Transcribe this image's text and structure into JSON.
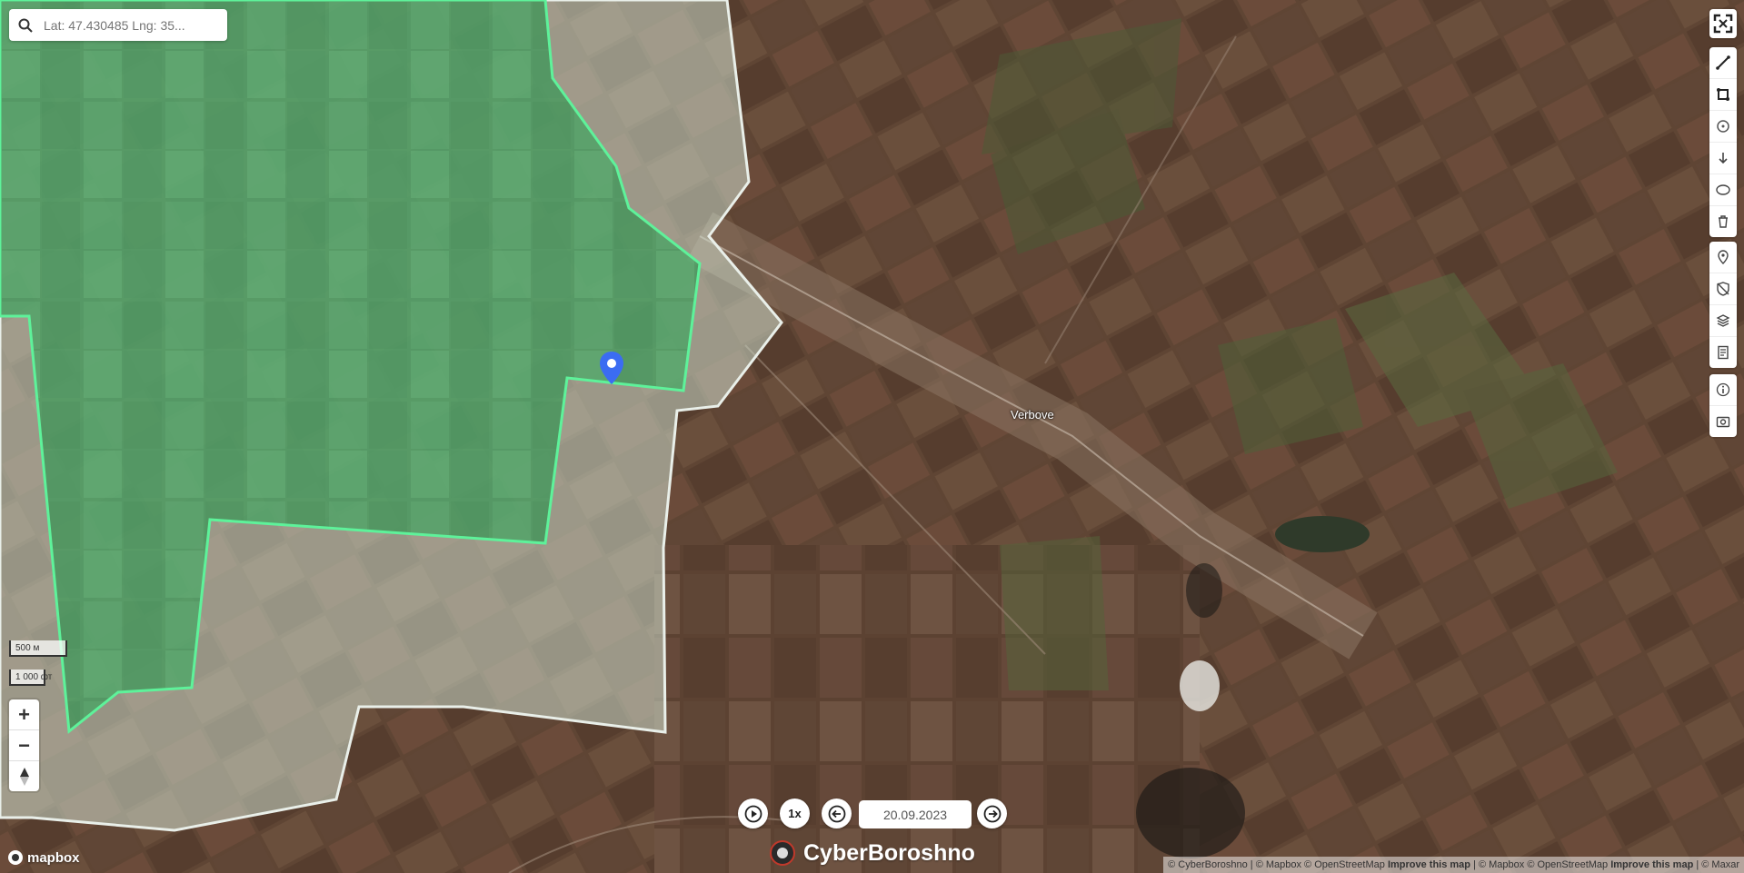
{
  "search": {
    "placeholder": "Lat: 47.430485 Lng: 35..."
  },
  "map": {
    "place_label": "Verbove",
    "colors": {
      "terrain": "#5e4332",
      "controlled_fill": "#43c36e",
      "controlled_border": "#5ef29a",
      "gray_zone_fill": "#c8d9c8",
      "gray_zone_border": "#e8eee8",
      "marker": "#3b6cf2"
    },
    "marker_icon": "map-pin-icon"
  },
  "scale": {
    "metric": "500 м",
    "imperial": "1 000 фт"
  },
  "zoom": {
    "in": "+",
    "out": "−",
    "compass": "compass-icon"
  },
  "toolbar": {
    "fullscreen_icon": "fullscreen-icon",
    "draw_tools": [
      "line-icon",
      "polygon-icon",
      "circle-icon",
      "arrow-down-icon",
      "ellipse-icon",
      "trash-icon"
    ],
    "layer_tools": [
      "pin-icon",
      "shield-icon",
      "layers-icon",
      "document-icon"
    ],
    "info_tools": [
      "info-icon",
      "screenshot-icon"
    ]
  },
  "timeline": {
    "speed": "1x",
    "date": "20.09.2023"
  },
  "brand": {
    "name": "CyberBoroshno"
  },
  "mapbox": {
    "label": "mapbox"
  },
  "attribution": {
    "part1": "© CyberBoroshno | © Mapbox © OpenStreetMap ",
    "improve1": "Improve this map",
    "part2": " | © Mapbox © OpenStreetMap ",
    "improve2": "Improve this map",
    "part3": " | © Maxar"
  }
}
